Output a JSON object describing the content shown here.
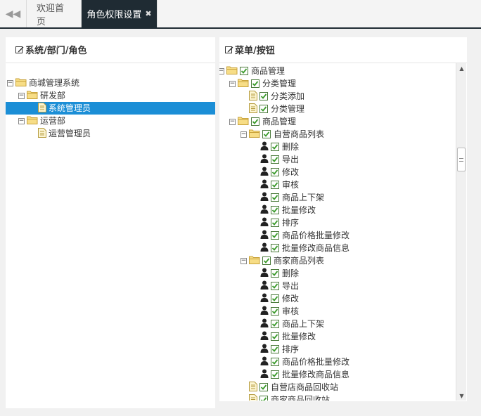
{
  "tabs": {
    "back_icon": "double-chevron-left-icon",
    "home_label": "欢迎首页",
    "active_label": "角色权限设置",
    "close_icon": "close-icon"
  },
  "left_panel": {
    "title": "系统/部门/角色",
    "nodes": [
      {
        "label": "商城管理系统",
        "level": 0,
        "type": "folder",
        "expanded": true
      },
      {
        "label": "研发部",
        "level": 1,
        "type": "folder",
        "expanded": true
      },
      {
        "label": "系统管理员",
        "level": 2,
        "type": "file",
        "selected": true
      },
      {
        "label": "运营部",
        "level": 1,
        "type": "folder",
        "expanded": true
      },
      {
        "label": "运营管理员",
        "level": 2,
        "type": "file"
      }
    ]
  },
  "right_panel": {
    "title": "菜单/按钮",
    "nodes": [
      {
        "label": "商品管理",
        "level": 0,
        "type": "folder",
        "checked": true
      },
      {
        "label": "分类管理",
        "level": 1,
        "type": "folder",
        "checked": true
      },
      {
        "label": "分类添加",
        "level": 2,
        "type": "file",
        "checked": true
      },
      {
        "label": "分类管理",
        "level": 2,
        "type": "file",
        "checked": true
      },
      {
        "label": "商品管理",
        "level": 1,
        "type": "folder",
        "checked": true
      },
      {
        "label": "自营商品列表",
        "level": 2,
        "type": "folder",
        "checked": true
      },
      {
        "label": "删除",
        "level": 3,
        "type": "user",
        "checked": true
      },
      {
        "label": "导出",
        "level": 3,
        "type": "user",
        "checked": true
      },
      {
        "label": "修改",
        "level": 3,
        "type": "user",
        "checked": true
      },
      {
        "label": "审核",
        "level": 3,
        "type": "user",
        "checked": true
      },
      {
        "label": "商品上下架",
        "level": 3,
        "type": "user",
        "checked": true
      },
      {
        "label": "批量修改",
        "level": 3,
        "type": "user",
        "checked": true
      },
      {
        "label": "排序",
        "level": 3,
        "type": "user",
        "checked": true
      },
      {
        "label": "商品价格批量修改",
        "level": 3,
        "type": "user",
        "checked": true
      },
      {
        "label": "批量修改商品信息",
        "level": 3,
        "type": "user",
        "checked": true
      },
      {
        "label": "商家商品列表",
        "level": 2,
        "type": "folder",
        "checked": true
      },
      {
        "label": "删除",
        "level": 3,
        "type": "user",
        "checked": true
      },
      {
        "label": "导出",
        "level": 3,
        "type": "user",
        "checked": true
      },
      {
        "label": "修改",
        "level": 3,
        "type": "user",
        "checked": true
      },
      {
        "label": "审核",
        "level": 3,
        "type": "user",
        "checked": true
      },
      {
        "label": "商品上下架",
        "level": 3,
        "type": "user",
        "checked": true
      },
      {
        "label": "批量修改",
        "level": 3,
        "type": "user",
        "checked": true
      },
      {
        "label": "排序",
        "level": 3,
        "type": "user",
        "checked": true
      },
      {
        "label": "商品价格批量修改",
        "level": 3,
        "type": "user",
        "checked": true
      },
      {
        "label": "批量修改商品信息",
        "level": 3,
        "type": "user",
        "checked": true
      },
      {
        "label": "自营店商品回收站",
        "level": 2,
        "type": "file",
        "checked": true
      },
      {
        "label": "商家商品回收站",
        "level": 2,
        "type": "file",
        "checked": true
      }
    ]
  },
  "colors": {
    "tab_active_bg": "#1f2b33",
    "selected_bg": "#1b8ed6",
    "check_color": "#3a9a2a",
    "folder_color": "#f5d76e"
  }
}
